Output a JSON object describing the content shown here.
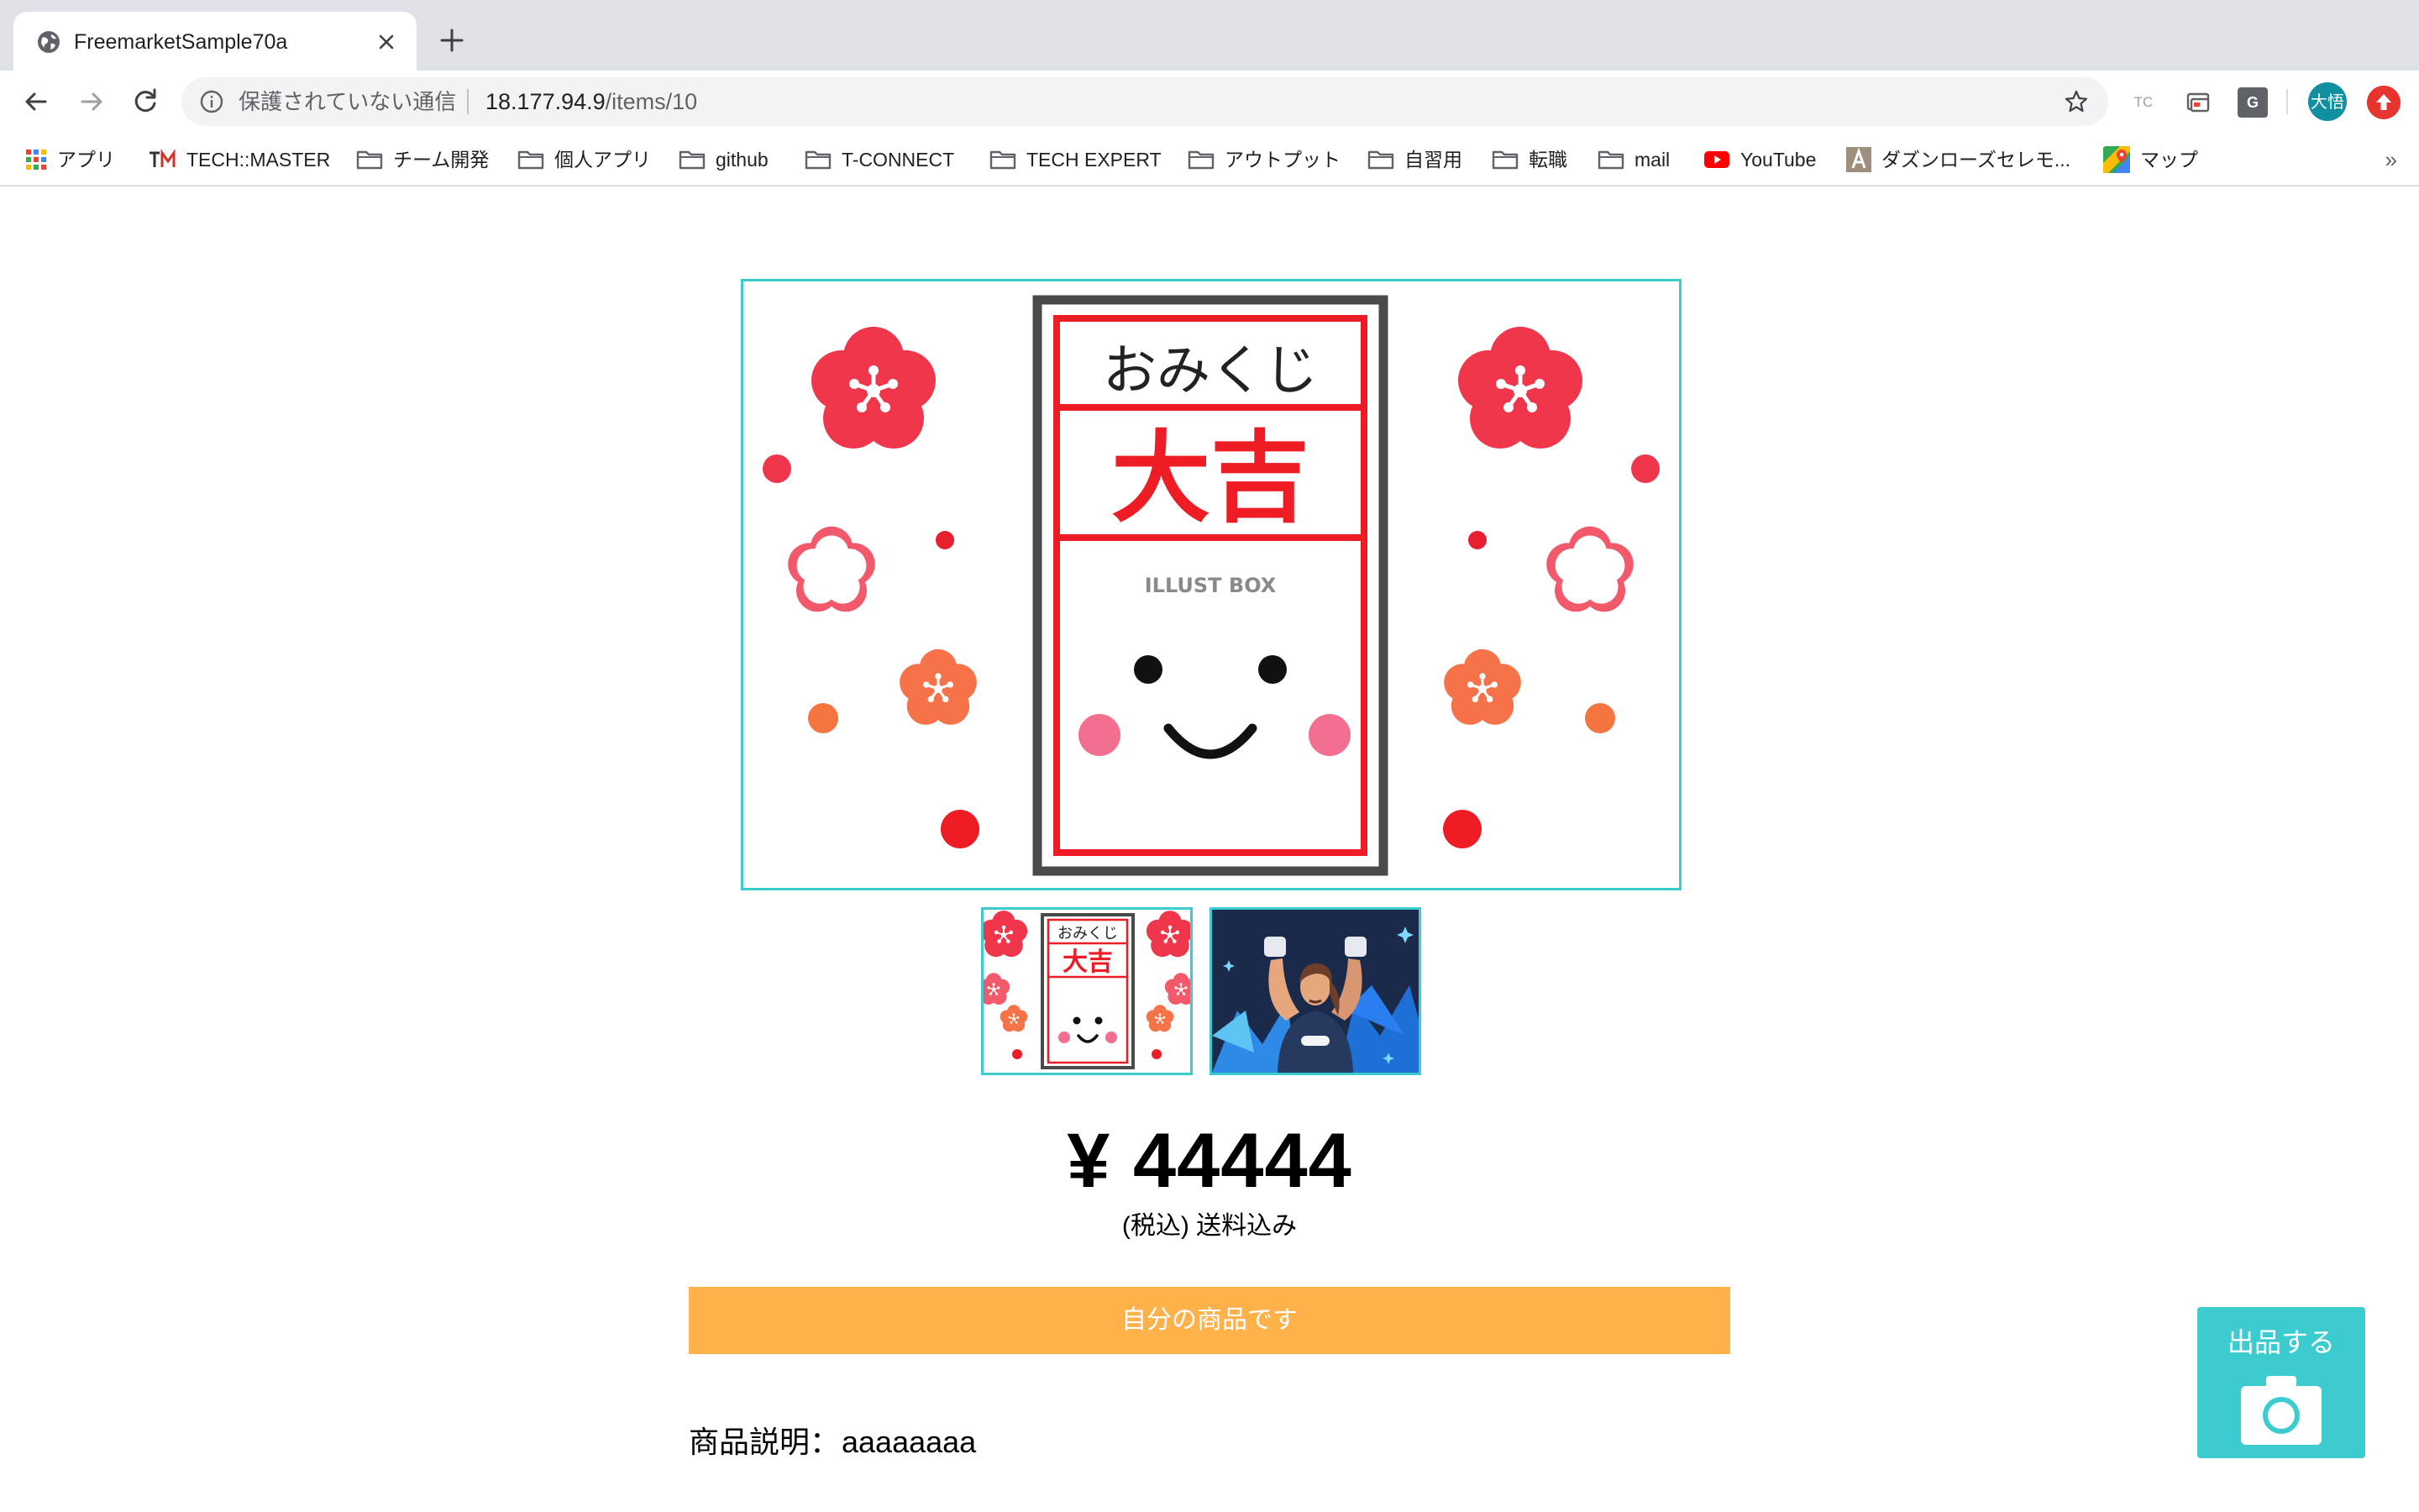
{
  "browser": {
    "tab_title": "FreemarketSample70a",
    "security_label": "保護されていない通信",
    "url_host": "18.177.94.9",
    "url_path": "/items/10",
    "profile_initials": "大悟",
    "ext_tc": "TC",
    "ext_g": "G"
  },
  "bookmarks": [
    {
      "label": "アプリ",
      "icon": "apps-grid-icon"
    },
    {
      "label": "TECH::MASTER",
      "icon": "techmaster-logo-icon"
    },
    {
      "label": "チーム開発",
      "icon": "folder-icon"
    },
    {
      "label": "個人アプリ",
      "icon": "folder-icon"
    },
    {
      "label": "github",
      "icon": "folder-icon"
    },
    {
      "label": "T-CONNECT",
      "icon": "folder-icon"
    },
    {
      "label": "TECH EXPERT",
      "icon": "folder-icon"
    },
    {
      "label": "アウトプット",
      "icon": "folder-icon"
    },
    {
      "label": "自習用",
      "icon": "folder-icon"
    },
    {
      "label": "転職",
      "icon": "folder-icon"
    },
    {
      "label": "mail",
      "icon": "folder-icon"
    },
    {
      "label": "YouTube",
      "icon": "youtube-icon"
    },
    {
      "label": "ダズンローズセレモ...",
      "icon": "a-logo-icon"
    },
    {
      "label": "マップ",
      "icon": "maps-icon"
    }
  ],
  "bookmarks_more": "»",
  "item": {
    "image_omikuji_title": "おみくじ",
    "image_omikuji_result": "大吉",
    "image_watermark": "ILLUST BOX",
    "price": "¥ 44444",
    "price_note": "(税込) 送料込み",
    "own_item_label": "自分の商品です",
    "description_label": "商品説明：",
    "description_value": "aaaaaaaa"
  },
  "sell_button": {
    "label": "出品する",
    "icon": "camera-icon"
  },
  "colors": {
    "accent": "#3ccccf",
    "own_button": "#ffb14a",
    "tab_bar": "#dee1e6",
    "omikuji_red": "#ee1c25"
  }
}
